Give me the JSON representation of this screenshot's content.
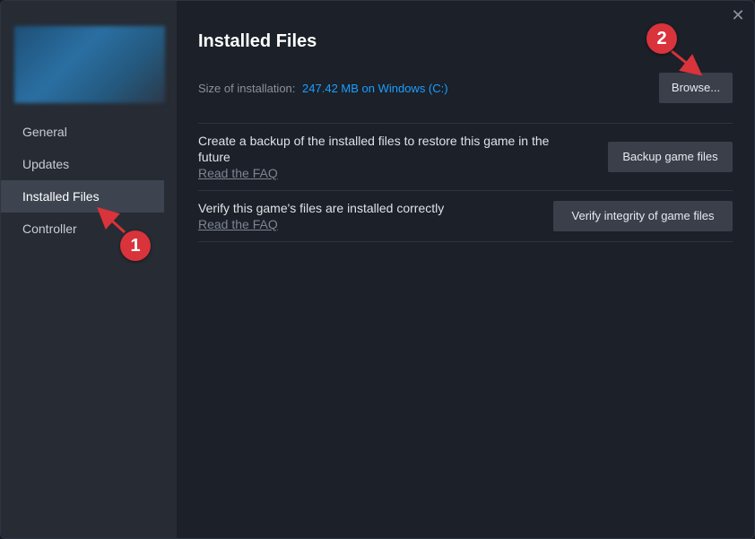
{
  "window": {
    "close_glyph": "✕"
  },
  "sidebar": {
    "items": [
      {
        "label": "General"
      },
      {
        "label": "Updates"
      },
      {
        "label": "Installed Files",
        "active": true
      },
      {
        "label": "Controller"
      }
    ]
  },
  "main": {
    "title": "Installed Files",
    "size_label": "Size of installation:",
    "size_value": "247.42 MB on Windows (C:)",
    "browse_label": "Browse...",
    "backup": {
      "description": "Create a backup of the installed files to restore this game in the future",
      "faq_label": "Read the FAQ",
      "button_label": "Backup game files"
    },
    "verify": {
      "description": "Verify this game's files are installed correctly",
      "faq_label": "Read the FAQ",
      "button_label": "Verify integrity of game files"
    }
  },
  "annotations": {
    "marker1": "1",
    "marker2": "2",
    "color": "#d9333b"
  },
  "colors": {
    "accent": "#1a9fff",
    "sidebar_bg": "#272b33",
    "main_bg": "#1b2029",
    "active_item_bg": "#3d4450",
    "button_bg": "#3a3f4a"
  }
}
